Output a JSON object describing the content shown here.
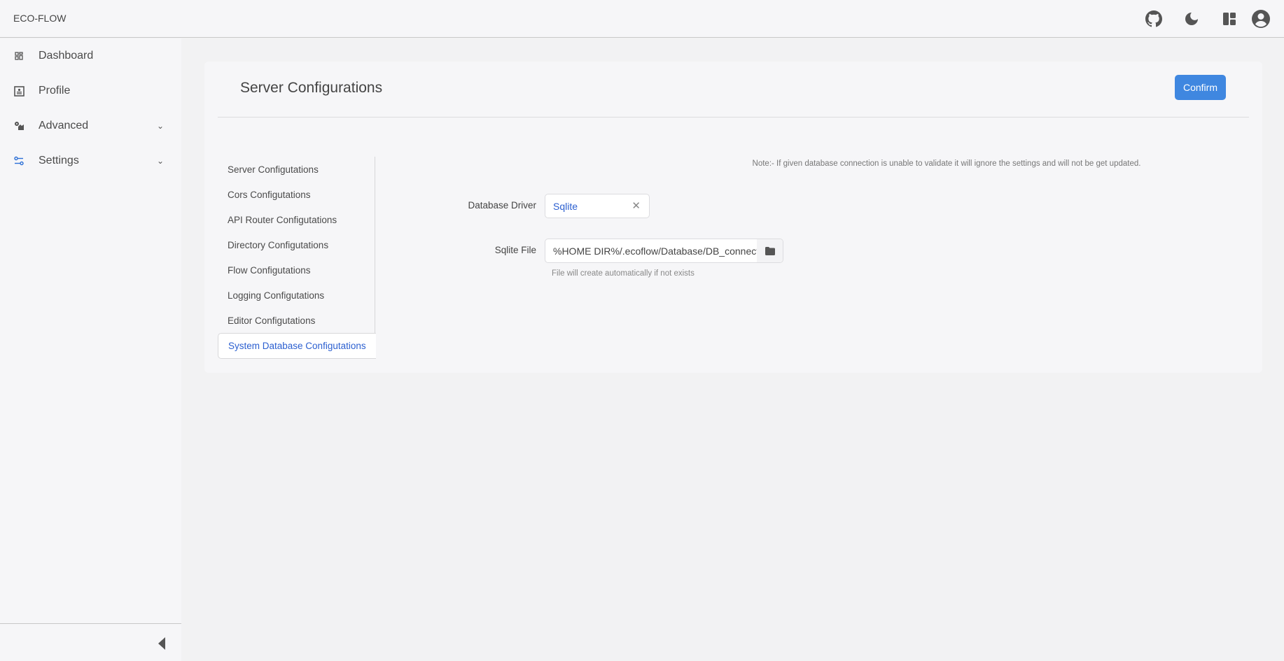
{
  "header": {
    "brand": "ECO-FLOW",
    "icons": [
      "github-icon",
      "moon-icon",
      "layout-icon",
      "account-icon"
    ]
  },
  "sidebar": {
    "items": [
      {
        "label": "Dashboard",
        "icon": "dashboard-icon"
      },
      {
        "label": "Profile",
        "icon": "profile-icon"
      },
      {
        "label": "Advanced",
        "icon": "gears-icon",
        "expandable": true
      },
      {
        "label": "Settings",
        "icon": "sliders-icon",
        "expandable": true,
        "active": true
      }
    ]
  },
  "page": {
    "title": "Server Configurations",
    "confirm_label": "Confirm",
    "menu": [
      "Server Configutations",
      "Cors Configutations",
      "API Router Configutations",
      "Directory Configutations",
      "Flow Configutations",
      "Logging Configutations",
      "Editor Configutations",
      "System Database Configutations"
    ],
    "active_menu": "System Database Configutations",
    "note": "Note:- If given database connection is unable to validate it will ignore the settings and will not be get updated.",
    "fields": {
      "driver_label": "Database Driver",
      "driver_value": "Sqlite",
      "file_label": "Sqlite File",
      "file_value": "%HOME DIR%/.ecoflow/Database/DB_connection",
      "file_help": "File will create automatically if not exists"
    }
  },
  "colors": {
    "accent": "#3f87e0",
    "active_text": "#2b5fd0"
  }
}
